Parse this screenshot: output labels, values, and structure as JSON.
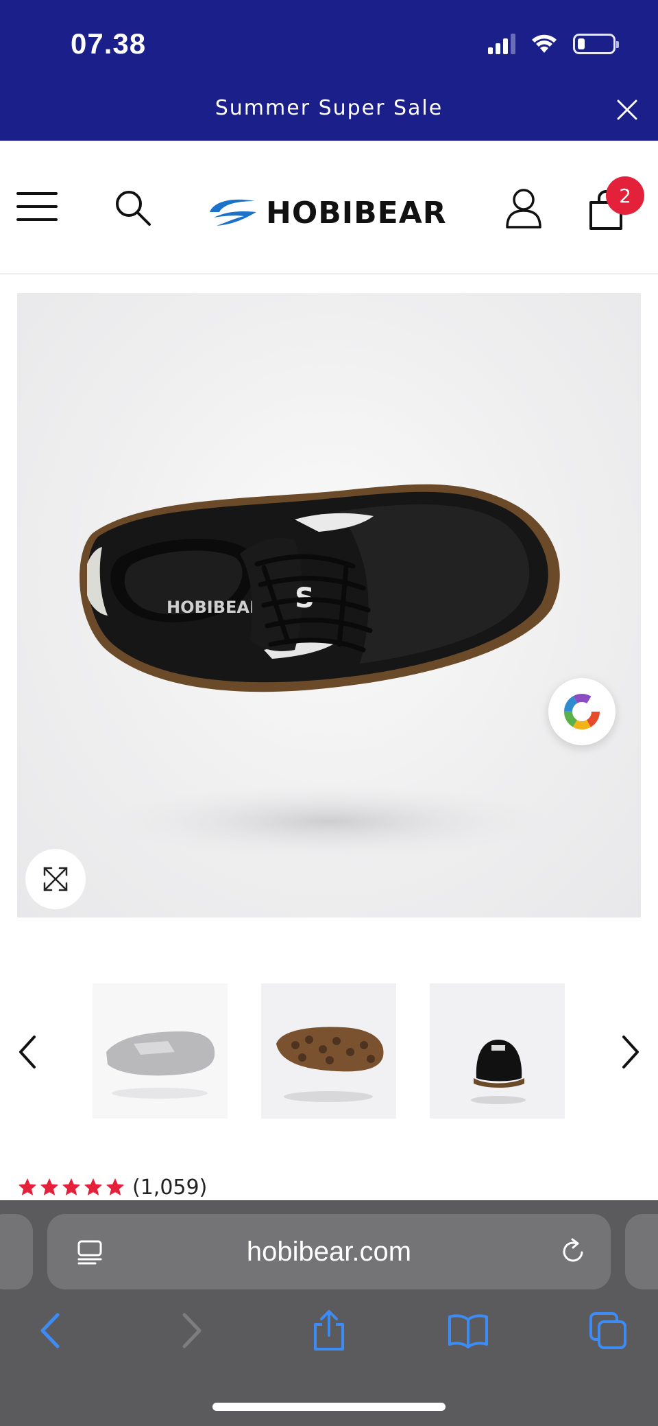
{
  "status_bar": {
    "time": "07.38",
    "signal_icon": "cellular-signal-icon",
    "wifi_icon": "wifi-icon",
    "battery_icon": "battery-icon",
    "battery_level": 0.15
  },
  "promo_bar": {
    "text": "Summer Super Sale",
    "close_icon": "close-icon",
    "background_color": "#1b1f8a"
  },
  "header": {
    "menu_icon": "hamburger-menu-icon",
    "search_icon": "search-icon",
    "logo_text": "HOBIBEAR",
    "account_icon": "user-icon",
    "cart_icon": "shopping-bag-icon",
    "cart_count": "2",
    "badge_color": "#e3213b"
  },
  "product": {
    "main_image": "black-barefoot-sneaker-photo",
    "insole_text": "HOBIBEAR",
    "color_picker_icon": "color-wheel-icon",
    "expand_icon": "expand-arrows-icon",
    "thumbnails": [
      {
        "name": "sneaker-side-view"
      },
      {
        "name": "sneaker-sole-view"
      },
      {
        "name": "sneaker-front-view"
      }
    ],
    "prev_icon": "chevron-left-icon",
    "next_icon": "chevron-right-icon",
    "rating": {
      "stars": 5,
      "count": "(1,059)",
      "star_color": "#e3213b"
    }
  },
  "browser": {
    "url": "hobibear.com",
    "reader_icon": "reader-mode-icon",
    "reload_icon": "reload-icon",
    "nav": {
      "back_icon": "back-arrow-icon",
      "forward_icon": "forward-arrow-icon",
      "share_icon": "share-icon",
      "bookmarks_icon": "bookmarks-book-icon",
      "tabs_icon": "tabs-icon"
    },
    "accent_color": "#3d8bf5"
  }
}
